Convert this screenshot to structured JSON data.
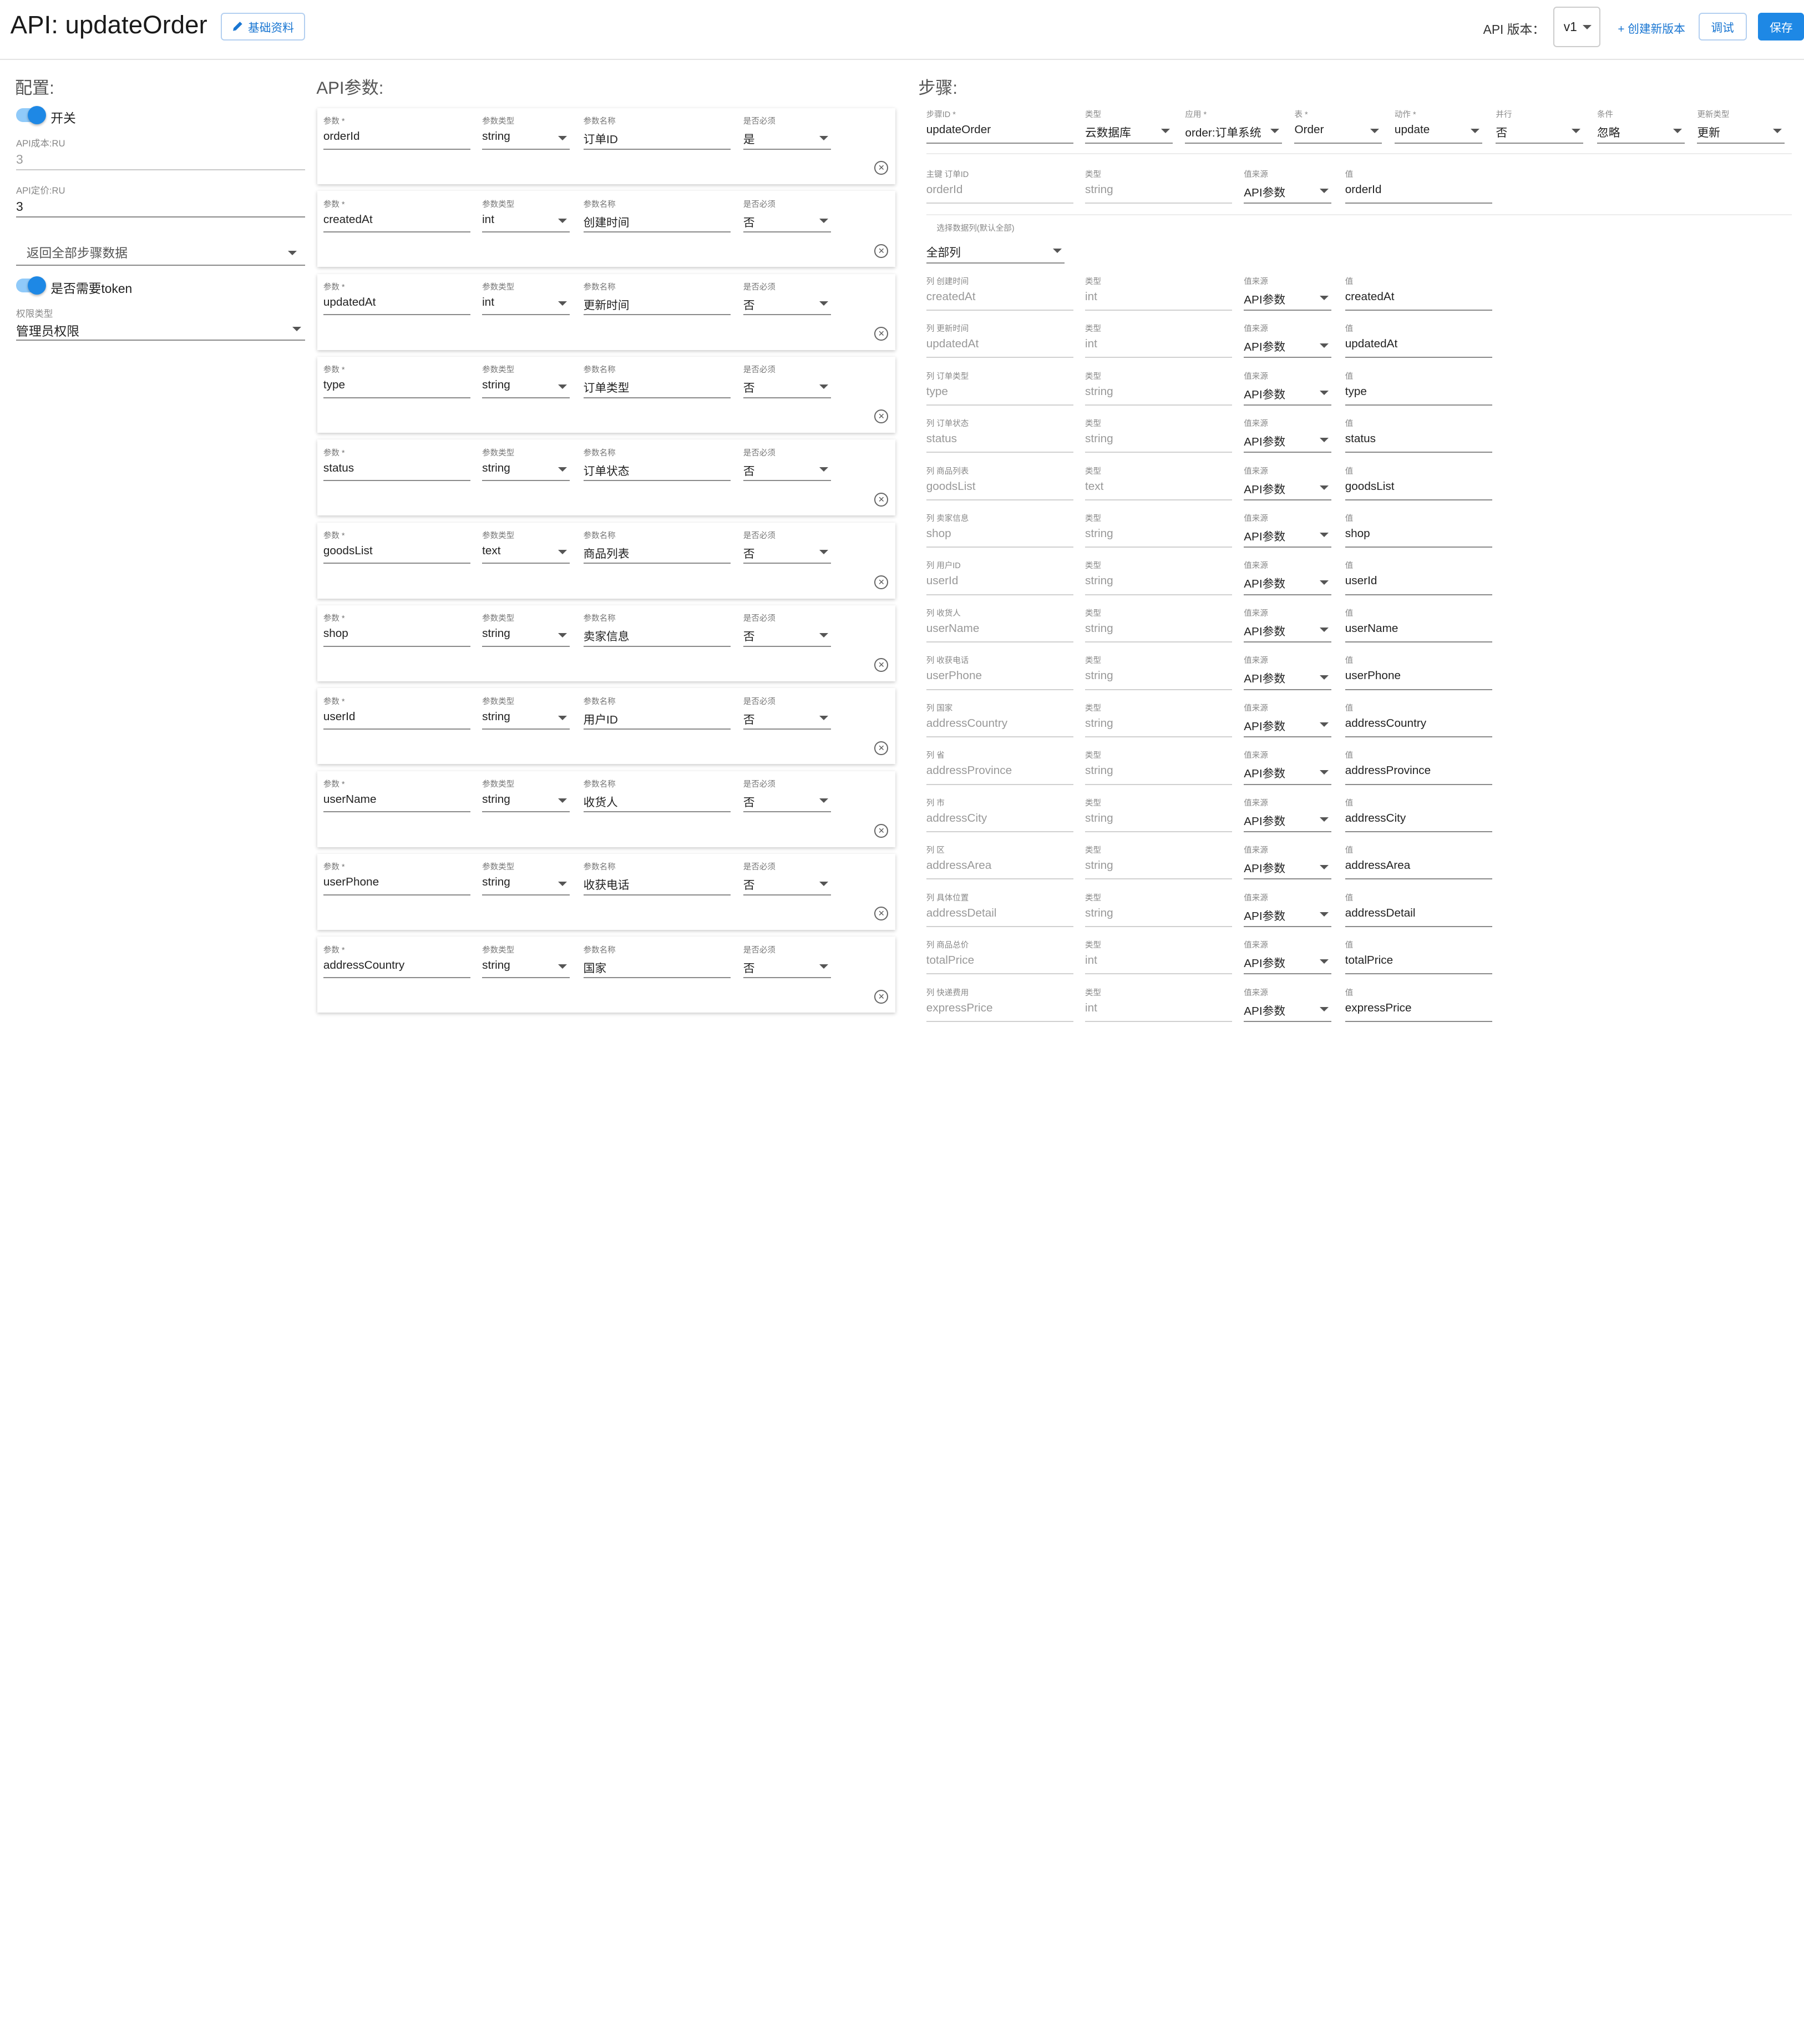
{
  "header": {
    "title": "API: updateOrder",
    "basic_info_label": "基础资料",
    "version_label": "API 版本：",
    "version_value": "v1",
    "create_version_label": "+ 创建新版本",
    "debug_label": "调试",
    "save_label": "保存"
  },
  "config": {
    "title": "配置:",
    "switch_label": "开关",
    "cost_label": "API成本:RU",
    "cost_value": "3",
    "price_label": "API定价:RU",
    "price_value": "3",
    "return_select": "返回全部步骤数据",
    "token_label": "是否需要token",
    "perm_label": "权限类型",
    "perm_value": "管理员权限"
  },
  "params": {
    "title": "API参数:",
    "labels": {
      "param": "参数 *",
      "type": "参数类型",
      "name": "参数名称",
      "required": "是否必须"
    },
    "items": [
      {
        "param": "orderId",
        "type": "string",
        "name": "订单ID",
        "required": "是"
      },
      {
        "param": "createdAt",
        "type": "int",
        "name": "创建时间",
        "required": "否"
      },
      {
        "param": "updatedAt",
        "type": "int",
        "name": "更新时间",
        "required": "否"
      },
      {
        "param": "type",
        "type": "string",
        "name": "订单类型",
        "required": "否"
      },
      {
        "param": "status",
        "type": "string",
        "name": "订单状态",
        "required": "否"
      },
      {
        "param": "goodsList",
        "type": "text",
        "name": "商品列表",
        "required": "否"
      },
      {
        "param": "shop",
        "type": "string",
        "name": "卖家信息",
        "required": "否"
      },
      {
        "param": "userId",
        "type": "string",
        "name": "用户ID",
        "required": "否"
      },
      {
        "param": "userName",
        "type": "string",
        "name": "收货人",
        "required": "否"
      },
      {
        "param": "userPhone",
        "type": "string",
        "name": "收获电话",
        "required": "否"
      },
      {
        "param": "addressCountry",
        "type": "string",
        "name": "国家",
        "required": "否"
      }
    ]
  },
  "steps": {
    "title": "步骤:",
    "head": [
      {
        "label": "步骤ID *",
        "value": "updateOrder",
        "select": false
      },
      {
        "label": "类型",
        "value": "云数据库",
        "select": true
      },
      {
        "label": "应用 *",
        "value": "order:订单系统",
        "select": true
      },
      {
        "label": "表 *",
        "value": "Order",
        "select": true
      },
      {
        "label": "动作 *",
        "value": "update",
        "select": true
      },
      {
        "label": "并行",
        "value": "否",
        "select": true
      },
      {
        "label": "条件",
        "value": "忽略",
        "select": true
      },
      {
        "label": "更新类型",
        "value": "更新",
        "select": true
      }
    ],
    "key_row": {
      "col_label": "主键 订单ID",
      "col_value": "orderId",
      "type_label": "类型",
      "type_value": "string",
      "src_label": "值来源",
      "src_value": "API参数",
      "val_label": "值",
      "val_value": "orderId"
    },
    "columns_select_label": "选择数据列(默认全部)",
    "columns_select_value": "全部列",
    "type_label": "类型",
    "src_label": "值来源",
    "val_label": "值",
    "rows": [
      {
        "col_label": "列 创建时间",
        "col": "createdAt",
        "type": "int",
        "src": "API参数",
        "val": "createdAt"
      },
      {
        "col_label": "列 更新时间",
        "col": "updatedAt",
        "type": "int",
        "src": "API参数",
        "val": "updatedAt"
      },
      {
        "col_label": "列 订单类型",
        "col": "type",
        "type": "string",
        "src": "API参数",
        "val": "type"
      },
      {
        "col_label": "列 订单状态",
        "col": "status",
        "type": "string",
        "src": "API参数",
        "val": "status"
      },
      {
        "col_label": "列 商品列表",
        "col": "goodsList",
        "type": "text",
        "src": "API参数",
        "val": "goodsList"
      },
      {
        "col_label": "列 卖家信息",
        "col": "shop",
        "type": "string",
        "src": "API参数",
        "val": "shop"
      },
      {
        "col_label": "列 用户ID",
        "col": "userId",
        "type": "string",
        "src": "API参数",
        "val": "userId"
      },
      {
        "col_label": "列 收货人",
        "col": "userName",
        "type": "string",
        "src": "API参数",
        "val": "userName"
      },
      {
        "col_label": "列 收获电话",
        "col": "userPhone",
        "type": "string",
        "src": "API参数",
        "val": "userPhone"
      },
      {
        "col_label": "列 国家",
        "col": "addressCountry",
        "type": "string",
        "src": "API参数",
        "val": "addressCountry"
      },
      {
        "col_label": "列 省",
        "col": "addressProvince",
        "type": "string",
        "src": "API参数",
        "val": "addressProvince"
      },
      {
        "col_label": "列 市",
        "col": "addressCity",
        "type": "string",
        "src": "API参数",
        "val": "addressCity"
      },
      {
        "col_label": "列 区",
        "col": "addressArea",
        "type": "string",
        "src": "API参数",
        "val": "addressArea"
      },
      {
        "col_label": "列 具体位置",
        "col": "addressDetail",
        "type": "string",
        "src": "API参数",
        "val": "addressDetail"
      },
      {
        "col_label": "列 商品总价",
        "col": "totalPrice",
        "type": "int",
        "src": "API参数",
        "val": "totalPrice"
      },
      {
        "col_label": "列 快递费用",
        "col": "expressPrice",
        "type": "int",
        "src": "API参数",
        "val": "expressPrice"
      }
    ]
  }
}
